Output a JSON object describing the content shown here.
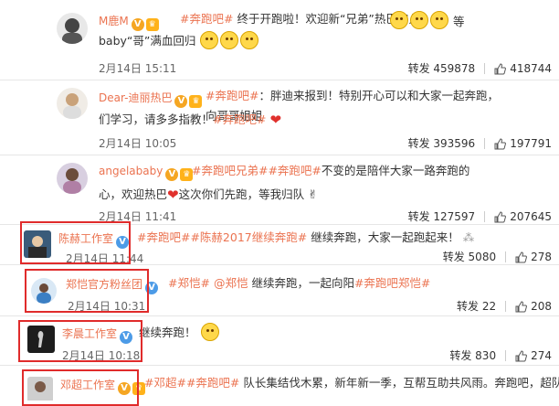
{
  "colors": {
    "accent": "#eb7350",
    "highlight": "#e02b2b",
    "text": "#333333",
    "badge_gold": "#f5a623",
    "badge_blue": "#4c9be7"
  },
  "comments": [
    {
      "user": "M鹿M",
      "tag": "#奔跑吧#",
      "text1": "终于开跑啦！欢迎新“兄弟”热巴加入",
      "text1b": "等",
      "text2": "baby“哥”满血回归",
      "time": "2月14日 15:11",
      "repost": "转发 459878",
      "likes": "418744"
    },
    {
      "user": "Dear-迪丽热巴",
      "tag": "#奔跑吧#",
      "text1": "：胖迪来报到！特别开心可以和大家一起奔跑，向哥哥姐姐",
      "text2": "们学习，请多多指教！",
      "tag2": "#奔跑吧#",
      "time": "2月14日 10:05",
      "repost": "转发 393596",
      "likes": "197791"
    },
    {
      "user": "angelababy",
      "tag": "#奔跑吧兄弟#",
      "tag2": "#奔跑吧#",
      "text1": "不变的是陪伴大家一路奔跑的",
      "text2a": "心，欢迎热巴",
      "text2b": "这次你们先跑，等我归队",
      "time": "2月14日 11:41",
      "repost": "转发 127597",
      "likes": "207645"
    },
    {
      "user": "陈赫工作室",
      "tag": "#奔跑吧#",
      "tag2": "#陈赫2017继续奔跑#",
      "text1": "继续奔跑，大家一起跑起来！",
      "time": "2月14日 11:44",
      "repost": "转发 5080",
      "likes": "278"
    },
    {
      "user": "郑恺官方粉丝团",
      "tag": "#郑恺#",
      "mention": "@郑恺",
      "text1": "继续奔跑，一起向阳",
      "tag2": "#奔跑吧郑恺#",
      "time": "2月14日 10:31",
      "repost": "转发 22",
      "likes": "208"
    },
    {
      "user": "李晨工作室",
      "text1": "继续奔跑！",
      "time": "2月14日 10:18",
      "repost": "转发 830",
      "likes": "274"
    },
    {
      "user": "邓超工作室",
      "tag": "#邓超#",
      "tag2": "#奔跑吧#",
      "text1": "队长集结伐木累，新年新一季，互帮互助共风雨。奔跑吧，超队"
    }
  ]
}
